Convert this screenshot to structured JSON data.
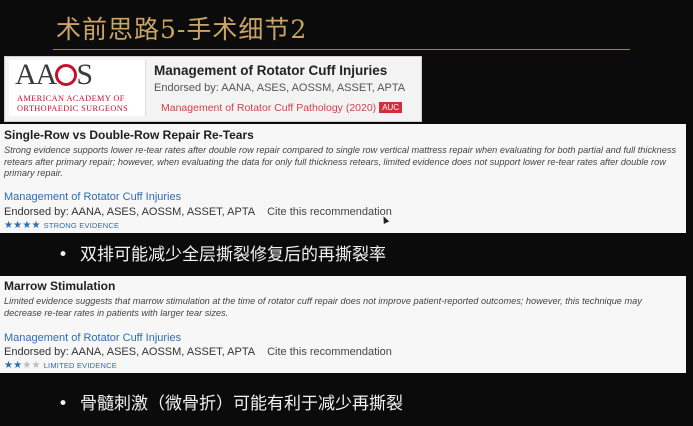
{
  "slide": {
    "title": "术前思路5-手术细节2"
  },
  "header_card": {
    "logo_text_left": "AA",
    "logo_text_right": "S",
    "logo_line1": "American Academy of",
    "logo_line2": "Orthopaedic Surgeons",
    "title": "Management of Rotator Cuff Injuries",
    "endorsed": "Endorsed by: AANA, ASES, AOSSM, ASSET, APTA",
    "link": "Management of Rotator Cuff Pathology (2020)",
    "badge": "AUC",
    "brand_color": "#c8102e"
  },
  "recommendations": [
    {
      "title": "Single-Row vs Double-Row Repair Re-Tears",
      "description": "Strong evidence supports lower re-tear rates after double row repair compared to single row vertical mattress repair when evaluating for both partial and full thickness retears after primary repair; however, when evaluating the data for only full thickness retears, limited evidence does not support lower re-tear rates after double row primary repair.",
      "guideline_link": "Management of Rotator Cuff Injuries",
      "endorsed": "Endorsed by: AANA, ASES, AOSSM, ASSET, APTA",
      "cite": "Cite this recommendation",
      "stars": "★★★★",
      "stars_off": "",
      "evidence_label": "STRONG EVIDENCE",
      "evidence_level": 4
    },
    {
      "title": "Marrow Stimulation",
      "description": "Limited evidence suggests that marrow stimulation at the time of rotator cuff repair does not improve patient-reported outcomes; however, this technique may decrease re-tear rates in patients with larger tear sizes.",
      "guideline_link": "Management of Rotator Cuff Injuries",
      "endorsed": "Endorsed by: AANA, ASES, AOSSM, ASSET, APTA",
      "cite": "Cite this recommendation",
      "stars": "★★",
      "stars_off": "★★",
      "evidence_label": "LIMITED EVIDENCE",
      "evidence_level": 2
    }
  ],
  "bullets": [
    {
      "marker": "•",
      "text": "双排可能减少全层撕裂修复后的再撕裂率"
    },
    {
      "marker": "•",
      "text": "骨髓刺激（微骨折）可能有利于减少再撕裂"
    }
  ],
  "colors": {
    "background": "#0b0b0b",
    "title": "#c9a465",
    "link_blue": "#2a6db5"
  }
}
